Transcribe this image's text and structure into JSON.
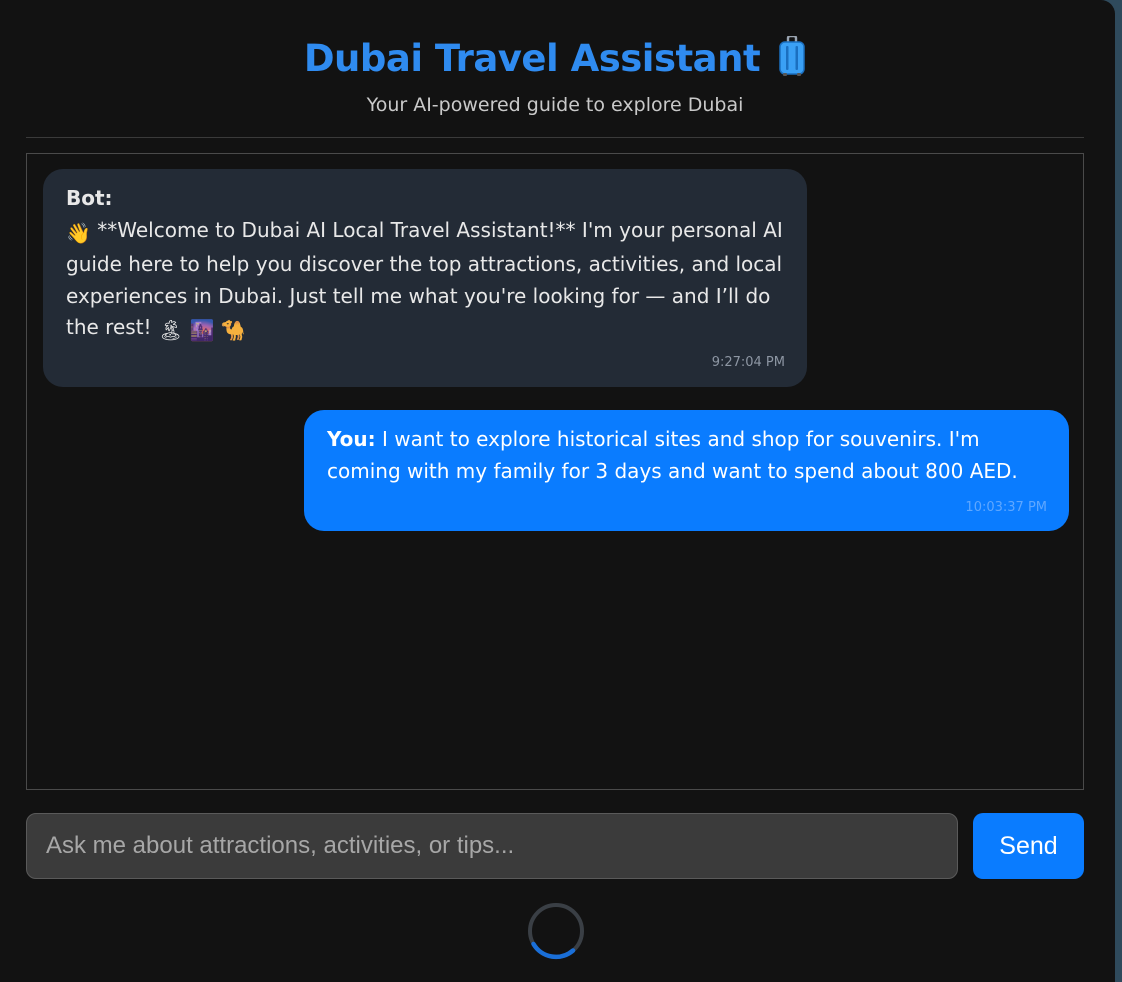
{
  "header": {
    "title": "Dubai Travel Assistant",
    "title_icon": "luggage-icon",
    "subtitle": "Your AI-powered guide to explore Dubai"
  },
  "messages": [
    {
      "role": "bot",
      "sender": "Bot:",
      "wave_emoji": "👋",
      "text": "**Welcome to Dubai AI Local Travel Assistant!** I'm your personal AI guide here to help you discover the top attractions, activities, and local experiences in Dubai. Just tell me what you're looking for — and I’ll do the rest!",
      "trailing_emojis": [
        "🏝",
        "🌆",
        "🐪"
      ],
      "time": "9:27:04 PM"
    },
    {
      "role": "user",
      "sender": "You:",
      "text": "I want to explore historical sites and shop for souvenirs. I'm coming with my family for 3 days and want to spend about 800 AED.",
      "time": "10:03:37 PM"
    }
  ],
  "input": {
    "placeholder": "Ask me about attractions, activities, or tips...",
    "value": ""
  },
  "send_button": {
    "label": "Send"
  },
  "loading_indicator": "spinner-icon",
  "colors": {
    "accent": "#0a7cff",
    "title": "#2f8bf0",
    "background": "#121212",
    "bot_bubble": "#232b36"
  }
}
